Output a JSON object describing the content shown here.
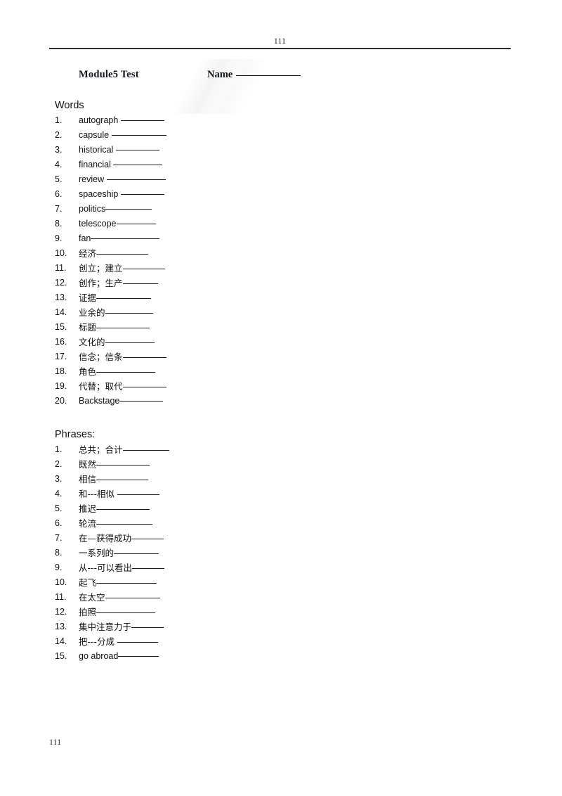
{
  "header": {
    "page_number": "111"
  },
  "title_row": {
    "title": "Module5 Test",
    "name_label": "Name"
  },
  "words_section": {
    "heading": "Words",
    "items": [
      {
        "num": "1.",
        "text": "autograph ",
        "blank_width": 62
      },
      {
        "num": "2.",
        "text": "capsule ",
        "blank_width": 78
      },
      {
        "num": "3.",
        "text": "historical ",
        "blank_width": 62
      },
      {
        "num": "4.",
        "text": "financial ",
        "blank_width": 70
      },
      {
        "num": "5.",
        "text": "review ",
        "blank_width": 84
      },
      {
        "num": "6.",
        "text": "spaceship ",
        "blank_width": 62
      },
      {
        "num": "7.",
        "text": "politics",
        "blank_width": 66
      },
      {
        "num": "8.",
        "text": "telescope",
        "blank_width": 56
      },
      {
        "num": "9.",
        "text": "fan",
        "blank_width": 98
      },
      {
        "num": "10.",
        "text": "经济",
        "blank_width": 74
      },
      {
        "num": "11.",
        "text": "创立；建立",
        "blank_width": 60
      },
      {
        "num": "12.",
        "text": "创作；生产",
        "blank_width": 50
      },
      {
        "num": "13.",
        "text": "证据",
        "blank_width": 78
      },
      {
        "num": "14.",
        "text": "业余的",
        "blank_width": 68
      },
      {
        "num": "15.",
        "text": "标题",
        "blank_width": 76
      },
      {
        "num": "16.",
        "text": "文化的",
        "blank_width": 70
      },
      {
        "num": "17.",
        "text": "信念；信条",
        "blank_width": 62
      },
      {
        "num": "18.",
        "text": "角色",
        "blank_width": 84
      },
      {
        "num": "19.",
        "text": "代替；取代",
        "blank_width": 62
      },
      {
        "num": "20.",
        "text": "Backstage",
        "blank_width": 62
      }
    ]
  },
  "phrases_section": {
    "heading": "Phrases:",
    "items": [
      {
        "num": "1.",
        "text": "总共；合计",
        "blank_width": 66
      },
      {
        "num": "2.",
        "text": "既然",
        "blank_width": 76
      },
      {
        "num": "3.",
        "text": "相信",
        "blank_width": 74
      },
      {
        "num": "4.",
        "text": "和---相似 ",
        "blank_width": 60
      },
      {
        "num": "5.",
        "text": "推迟",
        "blank_width": 76
      },
      {
        "num": "6.",
        "text": "轮流",
        "blank_width": 80
      },
      {
        "num": "7.",
        "text": "在—获得成功",
        "blank_width": 46
      },
      {
        "num": "8.",
        "text": "一系列的",
        "blank_width": 64
      },
      {
        "num": "9.",
        "text": "从---可以看出",
        "blank_width": 46
      },
      {
        "num": "10.",
        "text": "起飞",
        "blank_width": 86
      },
      {
        "num": "11.",
        "text": "在太空",
        "blank_width": 78
      },
      {
        "num": "12.",
        "text": "拍照",
        "blank_width": 84
      },
      {
        "num": "13.",
        "text": "集中注意力于",
        "blank_width": 46
      },
      {
        "num": "14.",
        "text": "把---分成 ",
        "blank_width": 58
      },
      {
        "num": "15.",
        "text": "go abroad",
        "blank_width": 58
      }
    ]
  },
  "footer": {
    "page_number": "111"
  }
}
